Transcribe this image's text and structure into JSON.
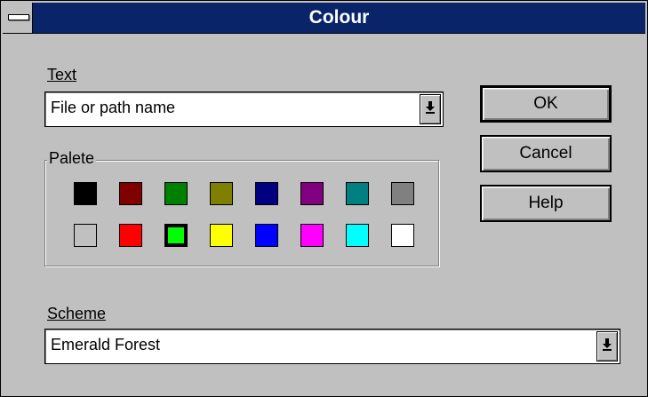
{
  "window": {
    "title": "Colour"
  },
  "text_field": {
    "label": "Text",
    "value": "File or path name"
  },
  "palette": {
    "label": "Palete",
    "row1": [
      {
        "name": "black",
        "color": "#000000"
      },
      {
        "name": "maroon",
        "color": "#800000"
      },
      {
        "name": "green",
        "color": "#008000"
      },
      {
        "name": "olive",
        "color": "#808000"
      },
      {
        "name": "navy",
        "color": "#000080"
      },
      {
        "name": "purple",
        "color": "#800080"
      },
      {
        "name": "teal",
        "color": "#008080"
      },
      {
        "name": "gray",
        "color": "#808080"
      }
    ],
    "row2": [
      {
        "name": "silver",
        "color": "#c0c0c0"
      },
      {
        "name": "red",
        "color": "#ff0000"
      },
      {
        "name": "lime",
        "color": "#00ff00",
        "selected": true
      },
      {
        "name": "yellow",
        "color": "#ffff00"
      },
      {
        "name": "blue",
        "color": "#0000ff"
      },
      {
        "name": "magenta",
        "color": "#ff00ff"
      },
      {
        "name": "cyan",
        "color": "#00ffff"
      },
      {
        "name": "white",
        "color": "#ffffff"
      }
    ]
  },
  "scheme_field": {
    "label": "Scheme",
    "value": "Emerald Forest"
  },
  "buttons": {
    "ok": "OK",
    "cancel": "Cancel",
    "help": "Help"
  },
  "colors": {
    "titlebar": "#0a246a",
    "face": "#c0c0c0"
  }
}
